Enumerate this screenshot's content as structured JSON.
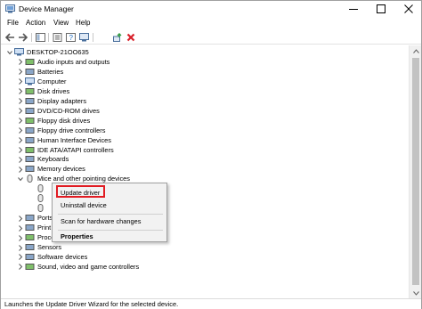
{
  "window": {
    "title": "Device Manager",
    "controls": {
      "minimize": "—",
      "maximize": "☐",
      "close": "✕"
    }
  },
  "menubar": {
    "items": [
      "File",
      "Action",
      "View",
      "Help"
    ]
  },
  "toolbar": {
    "buttons": [
      "back-icon",
      "forward-icon",
      "show-hide-console-tree-icon",
      "properties-icon",
      "help-icon",
      "show-computer-icon",
      "update-driver-icon",
      "uninstall-device-icon"
    ]
  },
  "tree": {
    "root": "DESKTOP-21OO635",
    "categories": [
      {
        "label": "Audio inputs and outputs",
        "icon": "audio-icon"
      },
      {
        "label": "Batteries",
        "icon": "battery-icon"
      },
      {
        "label": "Computer",
        "icon": "computer-icon"
      },
      {
        "label": "Disk drives",
        "icon": "disk-drive-icon"
      },
      {
        "label": "Display adapters",
        "icon": "display-adapter-icon"
      },
      {
        "label": "DVD/CD-ROM drives",
        "icon": "dvd-drive-icon"
      },
      {
        "label": "Floppy disk drives",
        "icon": "floppy-disk-icon"
      },
      {
        "label": "Floppy drive controllers",
        "icon": "floppy-controller-icon"
      },
      {
        "label": "Human Interface Devices",
        "icon": "hid-icon"
      },
      {
        "label": "IDE ATA/ATAPI controllers",
        "icon": "ide-controller-icon"
      },
      {
        "label": "Keyboards",
        "icon": "keyboard-icon"
      },
      {
        "label": "Memory devices",
        "icon": "memory-icon"
      },
      {
        "label": "Mice and other pointing devices",
        "icon": "mouse-icon",
        "expanded": true
      },
      {
        "label": "Ports (COM & LPT)",
        "icon": "port-icon",
        "partial": "Ports (COM & LPT)"
      },
      {
        "label": "Print queues",
        "icon": "printer-icon"
      },
      {
        "label": "Processors",
        "icon": "processor-icon"
      },
      {
        "label": "Sensors",
        "icon": "sensor-icon"
      },
      {
        "label": "Software devices",
        "icon": "software-device-icon"
      },
      {
        "label": "Sound, video and game controllers",
        "icon": "sound-icon"
      }
    ],
    "child_count_under_mice": 3
  },
  "context_menu": {
    "items": [
      {
        "label": "Update driver",
        "highlighted": true
      },
      {
        "label": "Uninstall device"
      },
      {
        "label": "Scan for hardware changes"
      },
      {
        "label": "Properties",
        "bold": true
      }
    ],
    "highlight_color": "#e11b22"
  },
  "statusbar": {
    "text": "Launches the Update Driver Wizard for the selected device."
  },
  "colors": {
    "accent_blue": "#1f6fc5",
    "delete_red": "#d8202a",
    "green": "#2e9a3e"
  }
}
